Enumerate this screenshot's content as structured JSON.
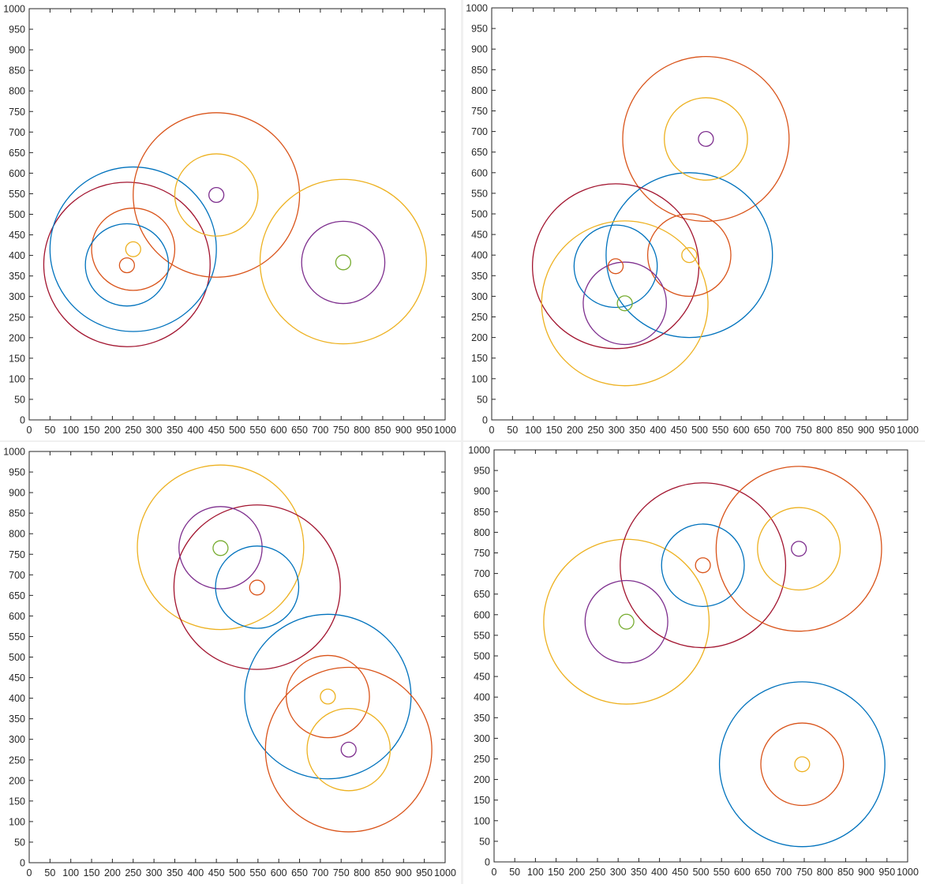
{
  "chart_data": [
    {
      "type": "scatter",
      "xlim": [
        0,
        1000
      ],
      "ylim": [
        0,
        1000
      ],
      "xticks": [
        0,
        50,
        100,
        150,
        200,
        250,
        300,
        350,
        400,
        450,
        500,
        550,
        600,
        650,
        700,
        750,
        800,
        850,
        900,
        950,
        1000
      ],
      "yticks": [
        0,
        50,
        100,
        150,
        200,
        250,
        300,
        350,
        400,
        450,
        500,
        550,
        600,
        650,
        700,
        750,
        800,
        850,
        900,
        950,
        1000
      ],
      "grid": false,
      "circles": [
        {
          "cx": 235,
          "cy": 378,
          "r": 200,
          "color": "#a2142f"
        },
        {
          "cx": 250,
          "cy": 415,
          "r": 200,
          "color": "#0072bd"
        },
        {
          "cx": 450,
          "cy": 547,
          "r": 200,
          "color": "#d95319"
        },
        {
          "cx": 755,
          "cy": 385,
          "r": 200,
          "color": "#edb120"
        },
        {
          "cx": 755,
          "cy": 383,
          "r": 100,
          "color": "#7e2f8e"
        },
        {
          "cx": 450,
          "cy": 547,
          "r": 100,
          "color": "#edb120"
        },
        {
          "cx": 250,
          "cy": 415,
          "r": 100,
          "color": "#d95319"
        },
        {
          "cx": 235,
          "cy": 377,
          "r": 100,
          "color": "#0072bd"
        },
        {
          "cx": 450,
          "cy": 547,
          "r": 18,
          "color": "#7e2f8e"
        },
        {
          "cx": 755,
          "cy": 383,
          "r": 18,
          "color": "#77ac30"
        },
        {
          "cx": 250,
          "cy": 415,
          "r": 18,
          "color": "#edb120"
        },
        {
          "cx": 235,
          "cy": 376,
          "r": 18,
          "color": "#d95319"
        }
      ]
    },
    {
      "type": "scatter",
      "xlim": [
        0,
        1000
      ],
      "ylim": [
        0,
        1000
      ],
      "xticks": [
        0,
        50,
        100,
        150,
        200,
        250,
        300,
        350,
        400,
        450,
        500,
        550,
        600,
        650,
        700,
        750,
        800,
        850,
        900,
        950,
        1000
      ],
      "yticks": [
        0,
        50,
        100,
        150,
        200,
        250,
        300,
        350,
        400,
        450,
        500,
        550,
        600,
        650,
        700,
        750,
        800,
        850,
        900,
        950,
        1000
      ],
      "grid": false,
      "circles": [
        {
          "cx": 515,
          "cy": 682,
          "r": 200,
          "color": "#d95319"
        },
        {
          "cx": 475,
          "cy": 400,
          "r": 200,
          "color": "#0072bd"
        },
        {
          "cx": 298,
          "cy": 373,
          "r": 200,
          "color": "#a2142f"
        },
        {
          "cx": 320,
          "cy": 283,
          "r": 200,
          "color": "#edb120"
        },
        {
          "cx": 515,
          "cy": 682,
          "r": 100,
          "color": "#edb120"
        },
        {
          "cx": 475,
          "cy": 400,
          "r": 100,
          "color": "#d95319"
        },
        {
          "cx": 298,
          "cy": 373,
          "r": 100,
          "color": "#0072bd"
        },
        {
          "cx": 320,
          "cy": 283,
          "r": 100,
          "color": "#7e2f8e"
        },
        {
          "cx": 515,
          "cy": 682,
          "r": 18,
          "color": "#7e2f8e"
        },
        {
          "cx": 475,
          "cy": 400,
          "r": 18,
          "color": "#edb120"
        },
        {
          "cx": 298,
          "cy": 373,
          "r": 18,
          "color": "#d95319"
        },
        {
          "cx": 320,
          "cy": 283,
          "r": 18,
          "color": "#77ac30"
        }
      ]
    },
    {
      "type": "scatter",
      "xlim": [
        0,
        1000
      ],
      "ylim": [
        0,
        1000
      ],
      "xticks": [
        0,
        50,
        100,
        150,
        200,
        250,
        300,
        350,
        400,
        450,
        500,
        550,
        600,
        650,
        700,
        750,
        800,
        850,
        900,
        950,
        1000
      ],
      "yticks": [
        0,
        50,
        100,
        150,
        200,
        250,
        300,
        350,
        400,
        450,
        500,
        550,
        600,
        650,
        700,
        750,
        800,
        850,
        900,
        950,
        1000
      ],
      "grid": false,
      "circles": [
        {
          "cx": 460,
          "cy": 767,
          "r": 200,
          "color": "#edb120"
        },
        {
          "cx": 548,
          "cy": 670,
          "r": 200,
          "color": "#a2142f"
        },
        {
          "cx": 718,
          "cy": 404,
          "r": 200,
          "color": "#0072bd"
        },
        {
          "cx": 768,
          "cy": 275,
          "r": 200,
          "color": "#d95319"
        },
        {
          "cx": 460,
          "cy": 766,
          "r": 100,
          "color": "#7e2f8e"
        },
        {
          "cx": 548,
          "cy": 670,
          "r": 100,
          "color": "#0072bd"
        },
        {
          "cx": 718,
          "cy": 404,
          "r": 100,
          "color": "#d95319"
        },
        {
          "cx": 768,
          "cy": 275,
          "r": 100,
          "color": "#edb120"
        },
        {
          "cx": 460,
          "cy": 765,
          "r": 18,
          "color": "#77ac30"
        },
        {
          "cx": 548,
          "cy": 669,
          "r": 18,
          "color": "#d95319"
        },
        {
          "cx": 718,
          "cy": 404,
          "r": 18,
          "color": "#edb120"
        },
        {
          "cx": 768,
          "cy": 275,
          "r": 18,
          "color": "#7e2f8e"
        }
      ]
    },
    {
      "type": "scatter",
      "xlim": [
        0,
        1000
      ],
      "ylim": [
        0,
        1000
      ],
      "xticks": [
        0,
        50,
        100,
        150,
        200,
        250,
        300,
        350,
        400,
        450,
        500,
        550,
        600,
        650,
        700,
        750,
        800,
        850,
        900,
        950,
        1000
      ],
      "yticks": [
        0,
        50,
        100,
        150,
        200,
        250,
        300,
        350,
        400,
        450,
        500,
        550,
        600,
        650,
        700,
        750,
        800,
        850,
        900,
        950,
        1000
      ],
      "grid": false,
      "circles": [
        {
          "cx": 320,
          "cy": 583,
          "r": 200,
          "color": "#edb120"
        },
        {
          "cx": 505,
          "cy": 720,
          "r": 200,
          "color": "#a2142f"
        },
        {
          "cx": 737,
          "cy": 760,
          "r": 200,
          "color": "#d95319"
        },
        {
          "cx": 745,
          "cy": 237,
          "r": 200,
          "color": "#0072bd"
        },
        {
          "cx": 320,
          "cy": 583,
          "r": 100,
          "color": "#7e2f8e"
        },
        {
          "cx": 505,
          "cy": 720,
          "r": 100,
          "color": "#0072bd"
        },
        {
          "cx": 737,
          "cy": 760,
          "r": 100,
          "color": "#edb120"
        },
        {
          "cx": 745,
          "cy": 237,
          "r": 100,
          "color": "#d95319"
        },
        {
          "cx": 320,
          "cy": 583,
          "r": 18,
          "color": "#77ac30"
        },
        {
          "cx": 505,
          "cy": 720,
          "r": 18,
          "color": "#d95319"
        },
        {
          "cx": 737,
          "cy": 760,
          "r": 18,
          "color": "#7e2f8e"
        },
        {
          "cx": 745,
          "cy": 237,
          "r": 18,
          "color": "#edb120"
        }
      ]
    }
  ]
}
